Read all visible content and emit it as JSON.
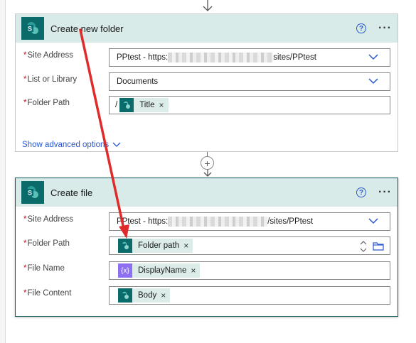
{
  "folder_card": {
    "title": "Create new folder",
    "fields": [
      {
        "label": "Site Address",
        "value_prefix": "PPtest - https:",
        "value_suffix": "sites/PPtest"
      },
      {
        "label": "List or Library",
        "value": "Documents"
      },
      {
        "label": "Folder Path",
        "prefix": "/",
        "token": "Title"
      }
    ],
    "advanced": "Show advanced options"
  },
  "file_card": {
    "title": "Create file",
    "fields": [
      {
        "label": "Site Address",
        "value_prefix": "PPtest - https:",
        "value_suffix": "/sites/PPtest"
      },
      {
        "label": "Folder Path",
        "token": "Folder path"
      },
      {
        "label": "File Name",
        "token": "DisplayName"
      },
      {
        "label": "File Content",
        "token": "Body"
      }
    ]
  },
  "required_mark": "*",
  "token_remove": "×",
  "var_icon_text": "{x}",
  "colors": {
    "header_bg": "#d9ebe9",
    "sharepoint_teal": "#0a6b6a",
    "link_blue": "#2a58d0",
    "annotation_red": "#e02b2b"
  }
}
